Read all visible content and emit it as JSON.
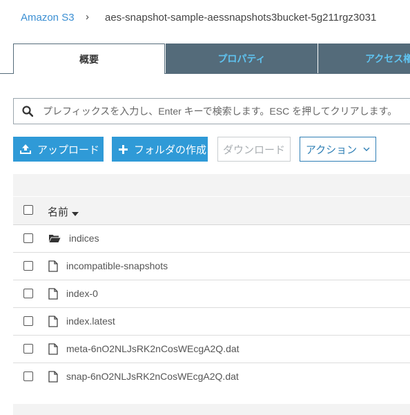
{
  "breadcrumb": {
    "root": "Amazon S3",
    "separator": "›",
    "current": "aes-snapshot-sample-aessnapshots3bucket-5g211rgz3031"
  },
  "tabs": [
    {
      "label": "概要",
      "active": true
    },
    {
      "label": "プロパティ",
      "active": false
    },
    {
      "label": "アクセス権限",
      "active": false
    }
  ],
  "search": {
    "placeholder": "プレフィックスを入力し、Enter キーで検索します。ESC を押してクリアします。",
    "value": ""
  },
  "toolbar": {
    "upload_label": "アップロード",
    "create_folder_label": "フォルダの作成",
    "download_label": "ダウンロード",
    "action_label": "アクション"
  },
  "table": {
    "name_header": "名前",
    "rows": [
      {
        "name": "indices",
        "type": "folder"
      },
      {
        "name": "incompatible-snapshots",
        "type": "file"
      },
      {
        "name": "index-0",
        "type": "file"
      },
      {
        "name": "index.latest",
        "type": "file"
      },
      {
        "name": "meta-6nO2NLJsRK2nCosWEcgA2Q.dat",
        "type": "file"
      },
      {
        "name": "snap-6nO2NLJsRK2nCosWEcgA2Q.dat",
        "type": "file"
      }
    ]
  },
  "colors": {
    "link": "#3b8fd3",
    "primary_button": "#2f9ad7",
    "tab_inactive_bg": "#546b7a",
    "tab_inactive_text": "#5fc3f0"
  }
}
